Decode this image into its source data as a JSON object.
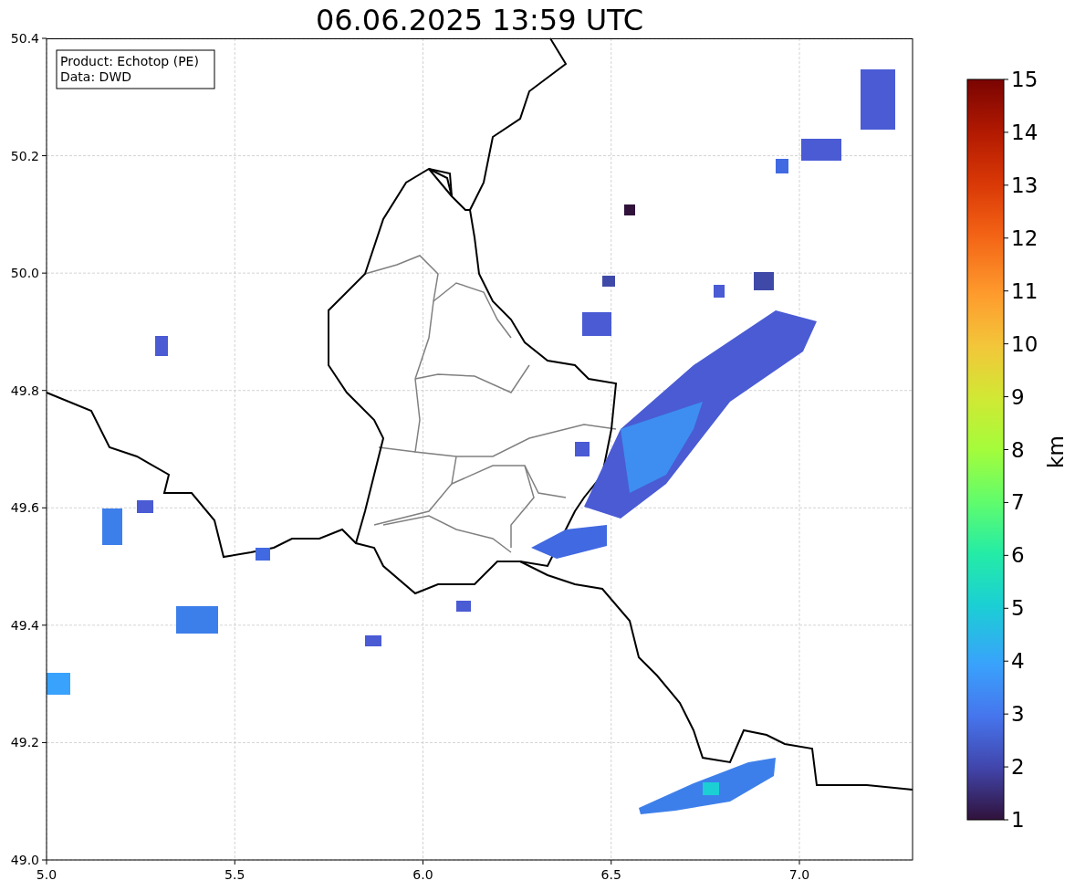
{
  "title": "06.06.2025 13:59 UTC",
  "info_box": {
    "lines": [
      "Product: Echotop (PE)",
      "Data: DWD"
    ]
  },
  "map": {
    "x_ticks": [
      "5.0",
      "5.5",
      "6.0",
      "6.5",
      "7.0"
    ],
    "y_ticks": [
      "50.4",
      "50.2",
      "50.0",
      "49.8",
      "49.6",
      "49.4",
      "49.2",
      "49.0"
    ]
  },
  "colorbar": {
    "ticks": [
      "15",
      "14",
      "13",
      "12",
      "11",
      "10",
      "9",
      "8",
      "7",
      "6",
      "5",
      "4",
      "3",
      "2",
      "1"
    ],
    "label": "km"
  }
}
